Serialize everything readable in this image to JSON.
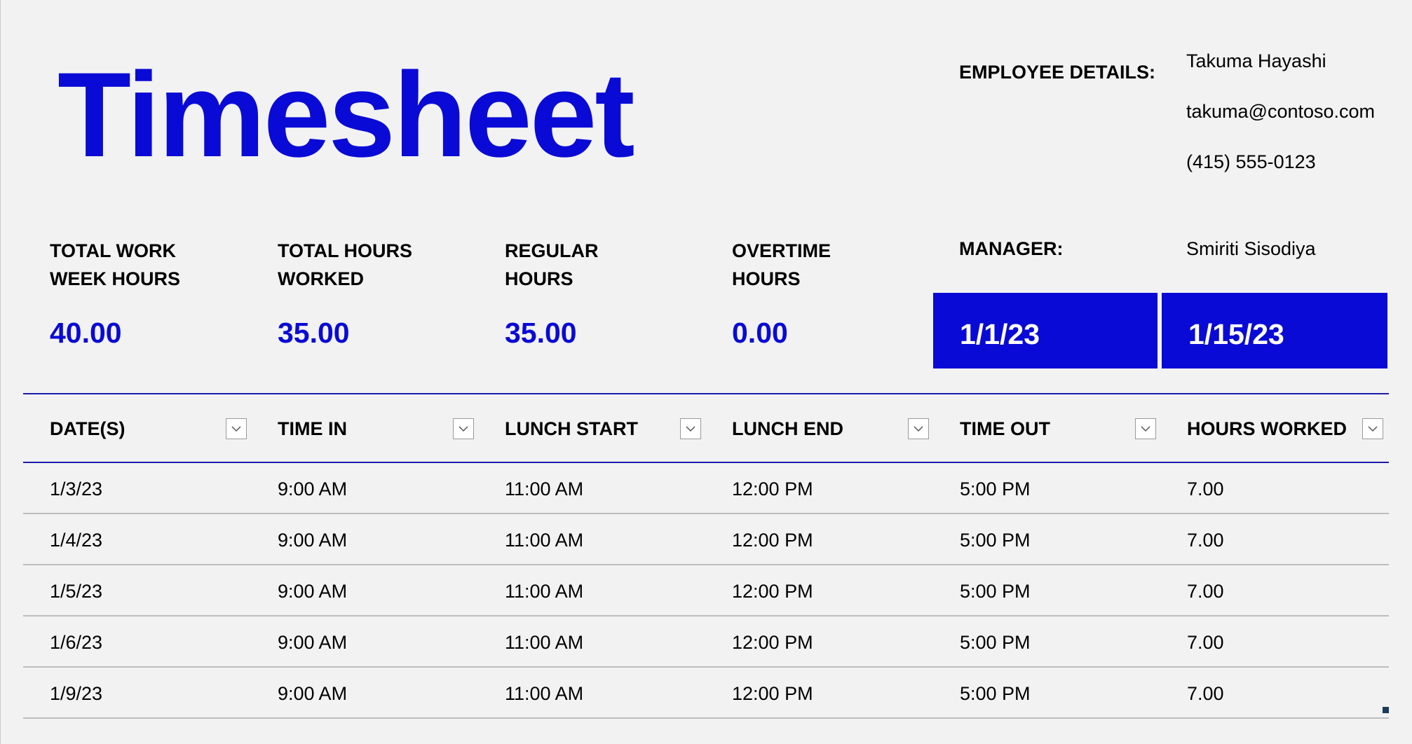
{
  "title": "Timesheet",
  "employee": {
    "label": "EMPLOYEE DETAILS:",
    "name": "Takuma Hayashi",
    "email": "takuma@contoso.com",
    "phone": "(415) 555-0123"
  },
  "stats": [
    {
      "label_line1": "TOTAL WORK",
      "label_line2": "WEEK HOURS",
      "value": "40.00"
    },
    {
      "label_line1": "TOTAL HOURS",
      "label_line2": "WORKED",
      "value": "35.00"
    },
    {
      "label_line1": "REGULAR",
      "label_line2": "HOURS",
      "value": "35.00"
    },
    {
      "label_line1": "OVERTIME",
      "label_line2": "HOURS",
      "value": "0.00"
    }
  ],
  "manager": {
    "label": "MANAGER:",
    "name": "Smiriti Sisodiya"
  },
  "period": {
    "start": "1/1/23",
    "end": "1/15/23"
  },
  "table": {
    "headers": [
      "DATE(S)",
      "TIME IN",
      "LUNCH START",
      "LUNCH END",
      "TIME OUT",
      "HOURS WORKED"
    ],
    "rows": [
      [
        "1/3/23",
        "9:00 AM",
        "11:00 AM",
        "12:00 PM",
        "5:00 PM",
        "7.00"
      ],
      [
        "1/4/23",
        "9:00 AM",
        "11:00 AM",
        "12:00 PM",
        "5:00 PM",
        "7.00"
      ],
      [
        "1/5/23",
        "9:00 AM",
        "11:00 AM",
        "12:00 PM",
        "5:00 PM",
        "7.00"
      ],
      [
        "1/6/23",
        "9:00 AM",
        "11:00 AM",
        "12:00 PM",
        "5:00 PM",
        "7.00"
      ],
      [
        "1/9/23",
        "9:00 AM",
        "11:00 AM",
        "12:00 PM",
        "5:00 PM",
        "7.00"
      ]
    ]
  },
  "colors": {
    "accent": "#0a0ad6",
    "background": "#f2f2f2",
    "header_rule": "#1c1caa",
    "row_rule": "#bdbdbd"
  },
  "icons": {
    "filter": "chevron-down-icon"
  }
}
